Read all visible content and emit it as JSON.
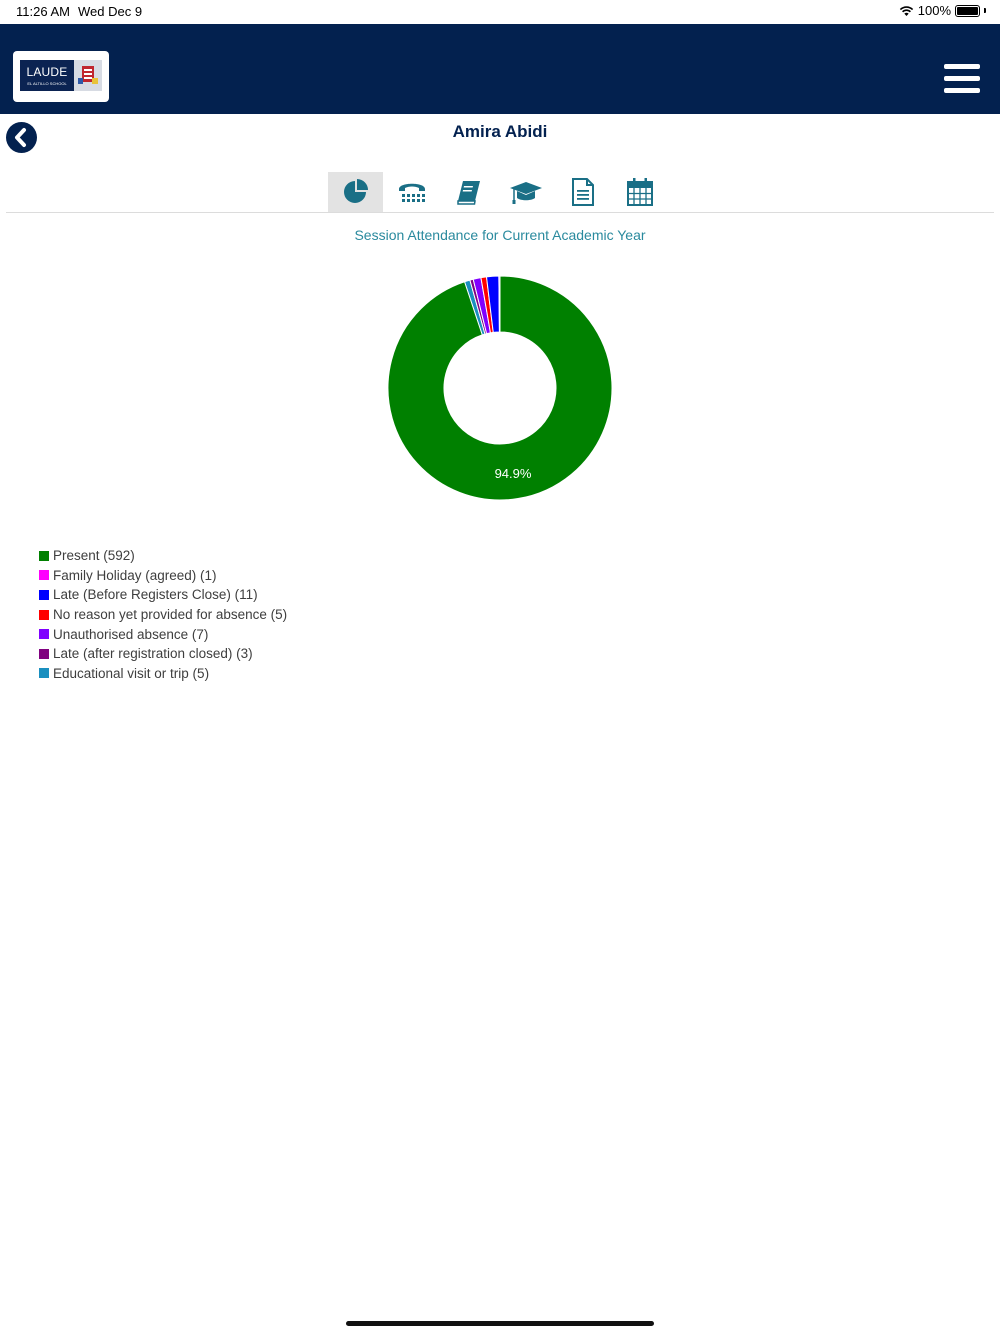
{
  "status_bar": {
    "time": "11:26 AM",
    "date": "Wed Dec 9",
    "battery": "100%"
  },
  "header": {
    "logo_text": "LAUDE",
    "logo_subtext": "EL ALTILLO SCHOOL"
  },
  "page": {
    "title": "Amira Abidi"
  },
  "tabs": [
    {
      "name": "attendance",
      "icon": "pie-chart-icon",
      "active": true
    },
    {
      "name": "contacts",
      "icon": "phone-icon",
      "active": false
    },
    {
      "name": "homework",
      "icon": "book-icon",
      "active": false
    },
    {
      "name": "grades",
      "icon": "graduation-cap-icon",
      "active": false
    },
    {
      "name": "reports",
      "icon": "document-icon",
      "active": false
    },
    {
      "name": "timetable",
      "icon": "calendar-icon",
      "active": false
    }
  ],
  "chart_data": {
    "type": "pie",
    "title": "Session Attendance for Current Academic Year",
    "series": [
      {
        "label": "Present (592)",
        "value": 592,
        "color": "#008000"
      },
      {
        "label": "Family Holiday (agreed) (1)",
        "value": 1,
        "color": "#ff00ff"
      },
      {
        "label": "Late (Before Registers Close) (11)",
        "value": 11,
        "color": "#0000ff"
      },
      {
        "label": "No reason yet provided for absence (5)",
        "value": 5,
        "color": "#ff0000"
      },
      {
        "label": "Unauthorised absence (7)",
        "value": 7,
        "color": "#8000ff"
      },
      {
        "label": "Late (after registration closed) (3)",
        "value": 3,
        "color": "#800080"
      },
      {
        "label": "Educational visit or trip (5)",
        "value": 5,
        "color": "#1a8fbf"
      }
    ],
    "data_labels": [
      "94.9%"
    ],
    "legend_position": "bottom-left"
  },
  "colors": {
    "header_bg": "#03214f",
    "accent": "#1a6f86",
    "title_color": "#03214f"
  }
}
